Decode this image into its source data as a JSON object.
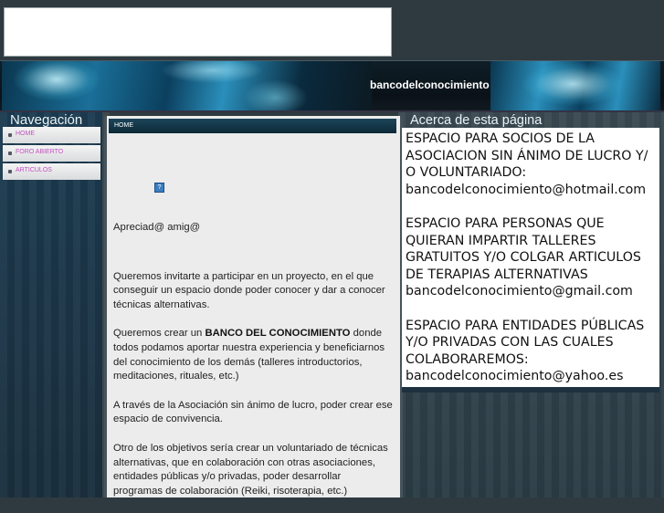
{
  "header": {
    "site_title": "bancodelconocimiento"
  },
  "nav": {
    "title": "Navegación",
    "items": [
      {
        "label": "HOME"
      },
      {
        "label": "FORO ABIERTO"
      },
      {
        "label": "ARTICULOS"
      }
    ]
  },
  "main": {
    "tab_label": "HOME",
    "help_icon_glyph": "?",
    "greeting": "Apreciad@ amig@",
    "p1": "Queremos invitarte a participar en un proyecto, en el que conseguir un espacio donde poder conocer y dar a conocer técnicas alternativas.",
    "p2_pre": "Queremos crear un ",
    "p2_bold": "BANCO DEL CONOCIMIENTO",
    "p2_post": " donde todos podamos aportar nuestra experiencia y beneficiarnos del conocimiento de los demás (talleres introductorios, meditaciones, rituales, etc.)",
    "p3": "A través de la Asociación sin ánimo de lucro, poder crear ese espacio de convivencia.",
    "p4": "Otro de los objetivos sería crear un voluntariado de técnicas alternativas, que en colaboración con otras asociaciones, entidades públicas y/o privadas, poder desarrollar programas de colaboración (Reiki, risoterapia, etc.)"
  },
  "about": {
    "title": "Acerca de esta página",
    "block1": {
      "text": "ESPACIO PARA SOCIOS DE LA ASOCIACION SIN ÁNIMO DE LUCRO Y/ O VOLUNTARIADO:",
      "email": "bancodelconocimiento@hotmail.com"
    },
    "block2": {
      "text": "ESPACIO PARA PERSONAS QUE QUIERAN IMPARTIR TALLERES GRATUITOS Y/O COLGAR ARTICULOS DE TERAPIAS ALTERNATIVAS",
      "email": "bancodelconocimiento@gmail.com"
    },
    "block3": {
      "text": "ESPACIO PARA ENTIDADES PÚBLICAS Y/O PRIVADAS CON LAS CUALES COLABORAREMOS:",
      "email": "bancodelconocimiento@yahoo.es"
    }
  }
}
